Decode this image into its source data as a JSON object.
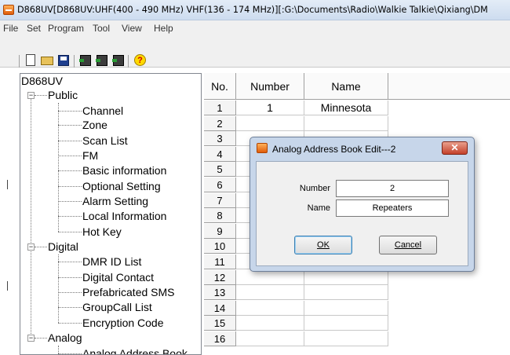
{
  "window": {
    "title": "D868UV[D868UV:UHF(400 - 490 MHz) VHF(136 - 174 MHz)][:G:\\Documents\\Radio\\Walkie Talkie\\Qixiang\\DM"
  },
  "menu": [
    "File",
    "Set",
    "Program",
    "Tool",
    "View",
    "Help"
  ],
  "toolbar": {
    "icons": [
      "new-file-icon",
      "open-folder-icon",
      "save-icon",
      "read-radio-icon",
      "write-radio-icon",
      "radio-transfer-icon",
      "help-icon"
    ]
  },
  "tree": {
    "root": "D868UV",
    "groups": [
      {
        "label": "Public",
        "expander": "−",
        "items": [
          "Channel",
          "Zone",
          "Scan List",
          "FM",
          "Basic information",
          "Optional Setting",
          "Alarm Setting",
          "Local Information",
          "Hot Key"
        ]
      },
      {
        "label": "Digital",
        "expander": "−",
        "items": [
          "DMR ID List",
          "Digital Contact",
          "Prefabricated SMS",
          "GroupCall List",
          "Encryption Code"
        ]
      },
      {
        "label": "Analog",
        "expander": "−",
        "items": [
          "Analog Address Book"
        ]
      }
    ]
  },
  "grid": {
    "headers": [
      "No.",
      "Number",
      "Name"
    ],
    "row_numbers": [
      "1",
      "2",
      "3",
      "4",
      "5",
      "6",
      "7",
      "8",
      "9",
      "10",
      "11",
      "12",
      "13",
      "14",
      "15",
      "16"
    ],
    "rows": [
      {
        "number": "1",
        "name": "Minnesota"
      }
    ]
  },
  "dialog": {
    "title": "Analog Address Book Edit---2",
    "close_glyph": "✕",
    "number_label": "Number",
    "number_value": "2",
    "name_label": "Name",
    "name_value": "Repeaters",
    "ok_label": "OK",
    "cancel_label": "Cancel"
  }
}
